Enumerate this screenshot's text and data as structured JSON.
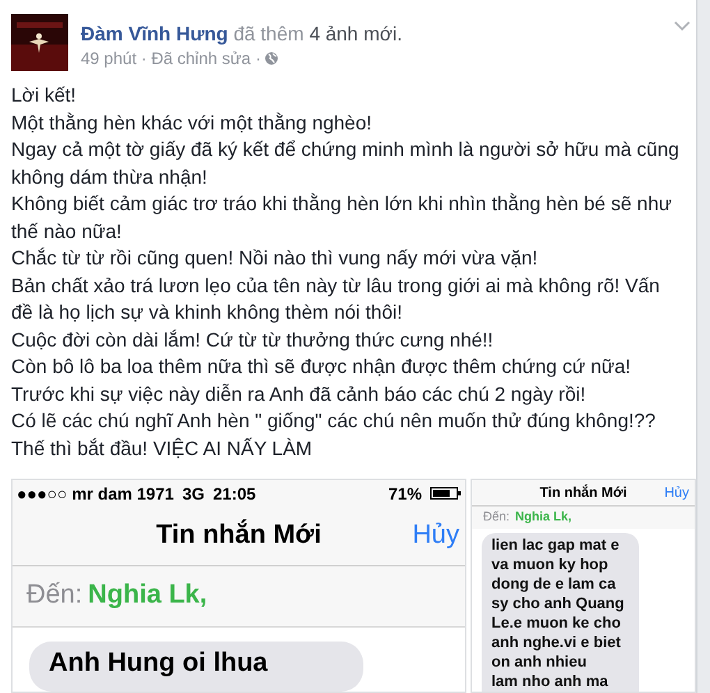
{
  "post": {
    "author": "Đàm Vĩnh Hưng",
    "action": "đã thêm",
    "action_object": "4 ảnh mới.",
    "meta": "49 phút · Đã chỉnh sửa ·",
    "body": [
      "Lời kết!",
      "Một thằng hèn khác với một thằng nghèo!",
      "Ngay cả một tờ giấy đã ký kết để chứng minh mình là người sở hữu mà cũng không dám thừa nhận!",
      "Không biết cảm giác trơ tráo khi thằng hèn lớn khi nhìn thằng hèn bé sẽ như thế nào nữa!",
      "Chắc từ từ rồi cũng quen! Nồi nào thì vung nấy mới vừa vặn!",
      "Bản chất xảo trá lươn lẹo của tên này từ lâu trong giới ai mà không rõ! Vấn đề là họ lịch sự và khinh không thèm nói thôi!",
      "Cuộc đời còn dài lắm! Cứ từ từ thưởng thức cưng nhé!!",
      "Còn bô lô ba loa thêm nữa thì sẽ được nhận được thêm chứng cứ nữa!",
      "Trước khi sự việc này diễn ra Anh đã cảnh báo các chú 2 ngày rồi!",
      "Có lẽ các chú nghĩ Anh hèn \" giống\" các chú nên muốn thử đúng không!??",
      "Thế thì bắt đầu! VIỆC AI NẤY LÀM"
    ]
  },
  "screenshots": [
    {
      "status": {
        "carrier": "●●●○○ mr dam 1971",
        "network": "3G",
        "time": "21:05",
        "battery": "71%"
      },
      "title": "Tin nhắn Mới",
      "cancel": "Hủy",
      "to_label": "Đến:",
      "recipient": "Nghia Lk,",
      "bubble_lines": [
        "Anh Hung oi lhua"
      ]
    },
    {
      "title": "Tin nhắn Mới",
      "cancel": "Hủy",
      "to_label": "Đến:",
      "recipient": "Nghia Lk,",
      "bubble_lines": [
        "lien lac gap mat e",
        "va muon ky hop",
        "dong de e lam ca",
        "sy cho anh Quang",
        "Le.e muon ke cho",
        "anh nghe.vi e biet",
        "on anh nhieu",
        "lam nho anh ma"
      ]
    }
  ]
}
